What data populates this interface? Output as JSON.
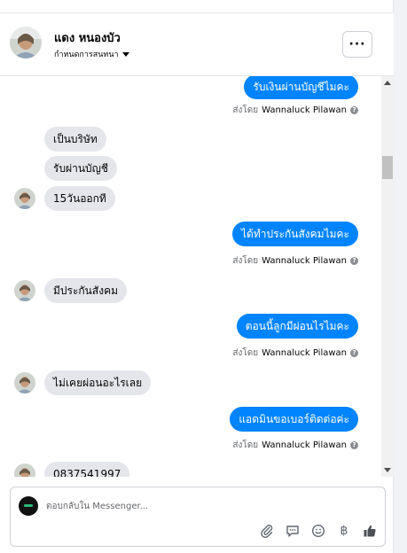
{
  "header": {
    "name": "แดง หนองบัว",
    "assign_label": "กำหนดการสนทนา",
    "more_label": "···"
  },
  "thread": {
    "messages": [
      {
        "side": "out",
        "text": "รับเงินผ่านบัญชีไมคะ",
        "sent_by_prefix": "ส่งโดย",
        "sender": "Wannaluck Pilawan"
      },
      {
        "side": "in",
        "text": "เป็นบริษัท"
      },
      {
        "side": "in",
        "text": "รับผ่านบัญชี"
      },
      {
        "side": "in",
        "text": "15วันออกที"
      },
      {
        "side": "out",
        "text": "ได้ทำประกันสังคมไมคะ",
        "sent_by_prefix": "ส่งโดย",
        "sender": "Wannaluck Pilawan"
      },
      {
        "side": "in",
        "text": "มีประกันสังคม"
      },
      {
        "side": "out",
        "text": "ตอนนี้ลูกมีผ่อนไรไมคะ",
        "sent_by_prefix": "ส่งโดย",
        "sender": "Wannaluck Pilawan"
      },
      {
        "side": "in",
        "text": "ไม่เคยผ่อนอะไรเลย"
      },
      {
        "side": "out",
        "text": "แอดมินขอเบอร์ติดต่อค่ะ",
        "sent_by_prefix": "ส่งโดย",
        "sender": "Wannaluck Pilawan"
      },
      {
        "side": "in",
        "text": "0837541997"
      }
    ]
  },
  "composer": {
    "placeholder": "ตอบกลับใน Messenger..."
  },
  "icons": {
    "attach": "paperclip-icon",
    "saved_reply": "chat-bubble-icon",
    "emoji": "smiley-icon",
    "payment": "baht-icon",
    "like": "thumbs-up-icon"
  },
  "colors": {
    "outgoing_bubble": "#0084ff",
    "incoming_bubble": "#e4e6eb"
  }
}
